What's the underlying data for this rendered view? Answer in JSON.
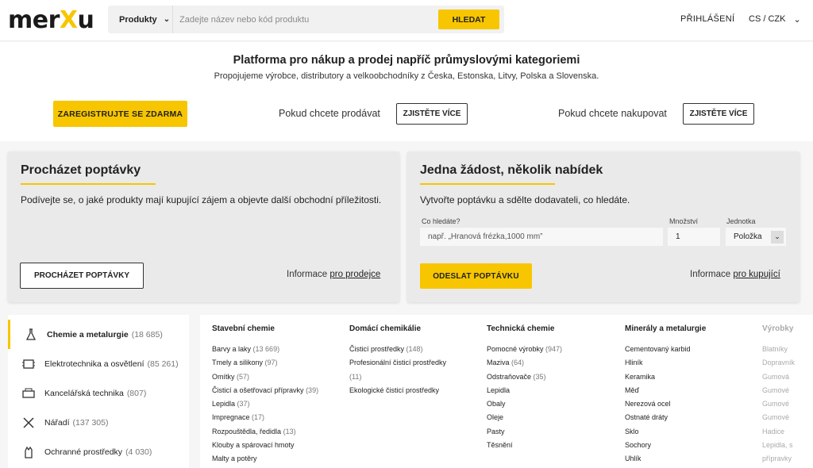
{
  "header": {
    "logo": {
      "pre": "mer",
      "x": "X",
      "post": "u"
    },
    "category_select": "Produkty",
    "search_placeholder": "Zadejte název nebo kód produktu",
    "search_button": "HLEDAT",
    "login": "PŘIHLÁŠENÍ",
    "language": "CS / CZK"
  },
  "hero": {
    "title": "Platforma pro nákup a prodej napříč průmyslovými kategoriemi",
    "subtitle": "Propojujeme výrobce, distributory a velkoobchodníky z Česka, Estonska, Litvy, Polska a Slovenska.",
    "register_button": "ZAREGISTRUJTE SE ZDARMA",
    "sell_text": "Pokud chcete prodávat",
    "sell_button": "ZJISTĚTE VÍCE",
    "buy_text": "Pokud chcete nakupovat",
    "buy_button": "ZJISTĚTE VÍCE"
  },
  "browse_card": {
    "title": "Procházet poptávky",
    "text": "Podívejte se, o jaké produkty mají kupující zájem a objevte další obchodní příležitosti.",
    "button": "PROCHÁZET POPTÁVKY",
    "info_prefix": "Informace",
    "info_link": "pro prodejce"
  },
  "request_card": {
    "title": "Jedna žádost, několik nabídek",
    "text": "Vytvořte poptávku a sdělte dodavateli, co hledáte.",
    "what_label": "Co hledáte?",
    "what_placeholder": "např. „Hranová frézka,1000 mm”",
    "qty_label": "Množství",
    "qty_value": "1",
    "unit_label": "Jednotka",
    "unit_value": "Položka",
    "button": "ODESLAT POPTÁVKU",
    "info_prefix": "Informace",
    "info_link": "pro kupující"
  },
  "sidebar": {
    "items": [
      {
        "label": "Chemie a metalurgie",
        "count": "(18 685)",
        "icon": "flask-icon"
      },
      {
        "label": "Elektrotechnika a osvětlení",
        "count": "(85 261)",
        "icon": "electronics-icon"
      },
      {
        "label": "Kancelářská technika",
        "count": "(807)",
        "icon": "printer-icon"
      },
      {
        "label": "Nářadí",
        "count": "(137 305)",
        "icon": "tools-icon"
      },
      {
        "label": "Ochranné prostředky",
        "count": "(4 030)",
        "icon": "glove-icon"
      }
    ]
  },
  "columns": [
    {
      "title": "Stavební chemie",
      "items": [
        {
          "label": "Barvy a laky",
          "count": "(13 669)"
        },
        {
          "label": "Tmely a silikony",
          "count": "(97)"
        },
        {
          "label": "Omítky",
          "count": "(57)"
        },
        {
          "label": "Čisticí a ošetřovací přípravky",
          "count": "(39)"
        },
        {
          "label": "Lepidla",
          "count": "(37)"
        },
        {
          "label": "Impregnace",
          "count": "(17)"
        },
        {
          "label": "Rozpouštědla, ředidla",
          "count": "(13)"
        },
        {
          "label": "Klouby a spárovací hmoty",
          "count": ""
        },
        {
          "label": "Malty a potěry",
          "count": ""
        }
      ]
    },
    {
      "title": "Domácí chemikálie",
      "items": [
        {
          "label": "Čisticí prostředky",
          "count": "(148)"
        },
        {
          "label": "Profesionální čisticí prostředky",
          "count": ""
        },
        {
          "label": "",
          "count": "(11)"
        },
        {
          "label": "Ekologické čisticí prostředky",
          "count": ""
        }
      ]
    },
    {
      "title": "Technická chemie",
      "items": [
        {
          "label": "Pomocné výrobky",
          "count": "(947)"
        },
        {
          "label": "Maziva",
          "count": "(64)"
        },
        {
          "label": "Odstraňovače",
          "count": "(35)"
        },
        {
          "label": "Lepidla",
          "count": ""
        },
        {
          "label": "Obaly",
          "count": ""
        },
        {
          "label": "Oleje",
          "count": ""
        },
        {
          "label": "Pasty",
          "count": ""
        },
        {
          "label": "Těsnění",
          "count": ""
        }
      ]
    },
    {
      "title": "Minerály a metalurgie",
      "items": [
        {
          "label": "Cementovaný karbid",
          "count": ""
        },
        {
          "label": "Hliník",
          "count": ""
        },
        {
          "label": "Keramika",
          "count": ""
        },
        {
          "label": "Měď",
          "count": ""
        },
        {
          "label": "Nerezová ocel",
          "count": ""
        },
        {
          "label": "Ostnaté dráty",
          "count": ""
        },
        {
          "label": "Sklo",
          "count": ""
        },
        {
          "label": "Sochory",
          "count": ""
        },
        {
          "label": "Uhlík",
          "count": ""
        }
      ]
    },
    {
      "title": "Výrobky",
      "items": [
        {
          "label": "Blatníky",
          "count": ""
        },
        {
          "label": "Dopravník",
          "count": ""
        },
        {
          "label": "Gumová",
          "count": ""
        },
        {
          "label": "Gumové",
          "count": ""
        },
        {
          "label": "Gumové",
          "count": ""
        },
        {
          "label": "Gumové",
          "count": ""
        },
        {
          "label": "Hadice",
          "count": ""
        },
        {
          "label": "Lepidla, s",
          "count": ""
        },
        {
          "label": "přípravky",
          "count": ""
        }
      ]
    }
  ]
}
